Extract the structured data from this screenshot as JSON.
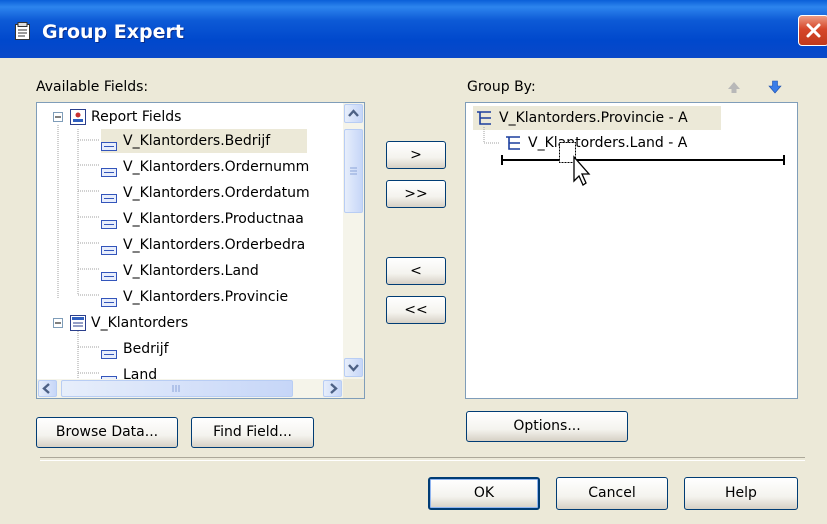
{
  "window": {
    "title": "Group Expert"
  },
  "available": {
    "label": "Available Fields:",
    "items": [
      {
        "label": "Report Fields",
        "icon": "report-fields-icon"
      },
      {
        "label": "V_Klantorders.Bedrijf",
        "icon": "field-icon"
      },
      {
        "label": "V_Klantorders.Ordernumm",
        "icon": "field-icon"
      },
      {
        "label": "V_Klantorders.Orderdatum",
        "icon": "field-icon"
      },
      {
        "label": "V_Klantorders.Productnaa",
        "icon": "field-icon"
      },
      {
        "label": "V_Klantorders.Orderbedra",
        "icon": "field-icon"
      },
      {
        "label": "V_Klantorders.Land",
        "icon": "field-icon"
      },
      {
        "label": "V_Klantorders.Provincie",
        "icon": "field-icon"
      },
      {
        "label": "V_Klantorders",
        "icon": "table-icon"
      },
      {
        "label": "Bedrijf",
        "icon": "field-icon"
      },
      {
        "label": "Land",
        "icon": "field-icon"
      }
    ],
    "selected_item": "V_Klantorders.Bedrijf"
  },
  "transfer": {
    "add_label": ">",
    "add_all_label": ">>",
    "remove_label": "<",
    "remove_all_label": "<<"
  },
  "group_by": {
    "label": "Group By:",
    "items": [
      {
        "label": "V_Klantorders.Provincie - A"
      },
      {
        "label": "V_Klantorders.Land - A"
      }
    ]
  },
  "buttons": {
    "browse_data": "Browse Data...",
    "find_field": "Find Field...",
    "options": "Options...",
    "ok": "OK",
    "cancel": "Cancel",
    "help": "Help"
  },
  "colors": {
    "titlebar": "#0048cc",
    "selection": "#ece9d8",
    "dialog_bg": "#ece9d8",
    "box_border": "#7f9db9"
  }
}
